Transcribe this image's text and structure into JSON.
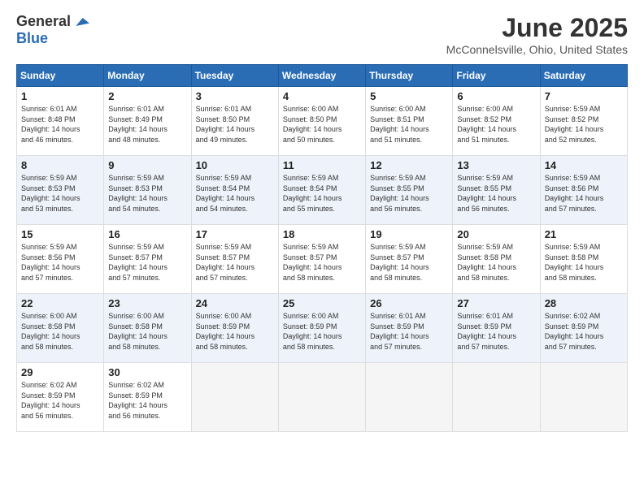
{
  "header": {
    "logo_general": "General",
    "logo_blue": "Blue",
    "month_title": "June 2025",
    "location": "McConnelsville, Ohio, United States"
  },
  "calendar": {
    "days_of_week": [
      "Sunday",
      "Monday",
      "Tuesday",
      "Wednesday",
      "Thursday",
      "Friday",
      "Saturday"
    ],
    "weeks": [
      [
        null,
        {
          "day": "2",
          "sunrise": "6:01 AM",
          "sunset": "8:49 PM",
          "daylight": "14 hours and 48 minutes."
        },
        {
          "day": "3",
          "sunrise": "6:01 AM",
          "sunset": "8:50 PM",
          "daylight": "14 hours and 49 minutes."
        },
        {
          "day": "4",
          "sunrise": "6:00 AM",
          "sunset": "8:50 PM",
          "daylight": "14 hours and 50 minutes."
        },
        {
          "day": "5",
          "sunrise": "6:00 AM",
          "sunset": "8:51 PM",
          "daylight": "14 hours and 51 minutes."
        },
        {
          "day": "6",
          "sunrise": "6:00 AM",
          "sunset": "8:52 PM",
          "daylight": "14 hours and 51 minutes."
        },
        {
          "day": "7",
          "sunrise": "5:59 AM",
          "sunset": "8:52 PM",
          "daylight": "14 hours and 52 minutes."
        }
      ],
      [
        {
          "day": "1",
          "sunrise": "6:01 AM",
          "sunset": "8:48 PM",
          "daylight": "14 hours and 46 minutes."
        },
        {
          "day": "8",
          "sunrise": "5:59 AM",
          "sunset": "8:53 PM",
          "daylight": "14 hours and 53 minutes."
        },
        {
          "day": "9",
          "sunrise": "5:59 AM",
          "sunset": "8:53 PM",
          "daylight": "14 hours and 54 minutes."
        },
        {
          "day": "10",
          "sunrise": "5:59 AM",
          "sunset": "8:54 PM",
          "daylight": "14 hours and 54 minutes."
        },
        {
          "day": "11",
          "sunrise": "5:59 AM",
          "sunset": "8:54 PM",
          "daylight": "14 hours and 55 minutes."
        },
        {
          "day": "12",
          "sunrise": "5:59 AM",
          "sunset": "8:55 PM",
          "daylight": "14 hours and 56 minutes."
        },
        {
          "day": "13",
          "sunrise": "5:59 AM",
          "sunset": "8:55 PM",
          "daylight": "14 hours and 56 minutes."
        },
        {
          "day": "14",
          "sunrise": "5:59 AM",
          "sunset": "8:56 PM",
          "daylight": "14 hours and 57 minutes."
        }
      ],
      [
        {
          "day": "15",
          "sunrise": "5:59 AM",
          "sunset": "8:56 PM",
          "daylight": "14 hours and 57 minutes."
        },
        {
          "day": "16",
          "sunrise": "5:59 AM",
          "sunset": "8:57 PM",
          "daylight": "14 hours and 57 minutes."
        },
        {
          "day": "17",
          "sunrise": "5:59 AM",
          "sunset": "8:57 PM",
          "daylight": "14 hours and 57 minutes."
        },
        {
          "day": "18",
          "sunrise": "5:59 AM",
          "sunset": "8:57 PM",
          "daylight": "14 hours and 58 minutes."
        },
        {
          "day": "19",
          "sunrise": "5:59 AM",
          "sunset": "8:57 PM",
          "daylight": "14 hours and 58 minutes."
        },
        {
          "day": "20",
          "sunrise": "5:59 AM",
          "sunset": "8:58 PM",
          "daylight": "14 hours and 58 minutes."
        },
        {
          "day": "21",
          "sunrise": "5:59 AM",
          "sunset": "8:58 PM",
          "daylight": "14 hours and 58 minutes."
        }
      ],
      [
        {
          "day": "22",
          "sunrise": "6:00 AM",
          "sunset": "8:58 PM",
          "daylight": "14 hours and 58 minutes."
        },
        {
          "day": "23",
          "sunrise": "6:00 AM",
          "sunset": "8:58 PM",
          "daylight": "14 hours and 58 minutes."
        },
        {
          "day": "24",
          "sunrise": "6:00 AM",
          "sunset": "8:59 PM",
          "daylight": "14 hours and 58 minutes."
        },
        {
          "day": "25",
          "sunrise": "6:00 AM",
          "sunset": "8:59 PM",
          "daylight": "14 hours and 58 minutes."
        },
        {
          "day": "26",
          "sunrise": "6:01 AM",
          "sunset": "8:59 PM",
          "daylight": "14 hours and 57 minutes."
        },
        {
          "day": "27",
          "sunrise": "6:01 AM",
          "sunset": "8:59 PM",
          "daylight": "14 hours and 57 minutes."
        },
        {
          "day": "28",
          "sunrise": "6:02 AM",
          "sunset": "8:59 PM",
          "daylight": "14 hours and 57 minutes."
        }
      ],
      [
        {
          "day": "29",
          "sunrise": "6:02 AM",
          "sunset": "8:59 PM",
          "daylight": "14 hours and 56 minutes."
        },
        {
          "day": "30",
          "sunrise": "6:02 AM",
          "sunset": "8:59 PM",
          "daylight": "14 hours and 56 minutes."
        },
        null,
        null,
        null,
        null,
        null
      ]
    ]
  }
}
